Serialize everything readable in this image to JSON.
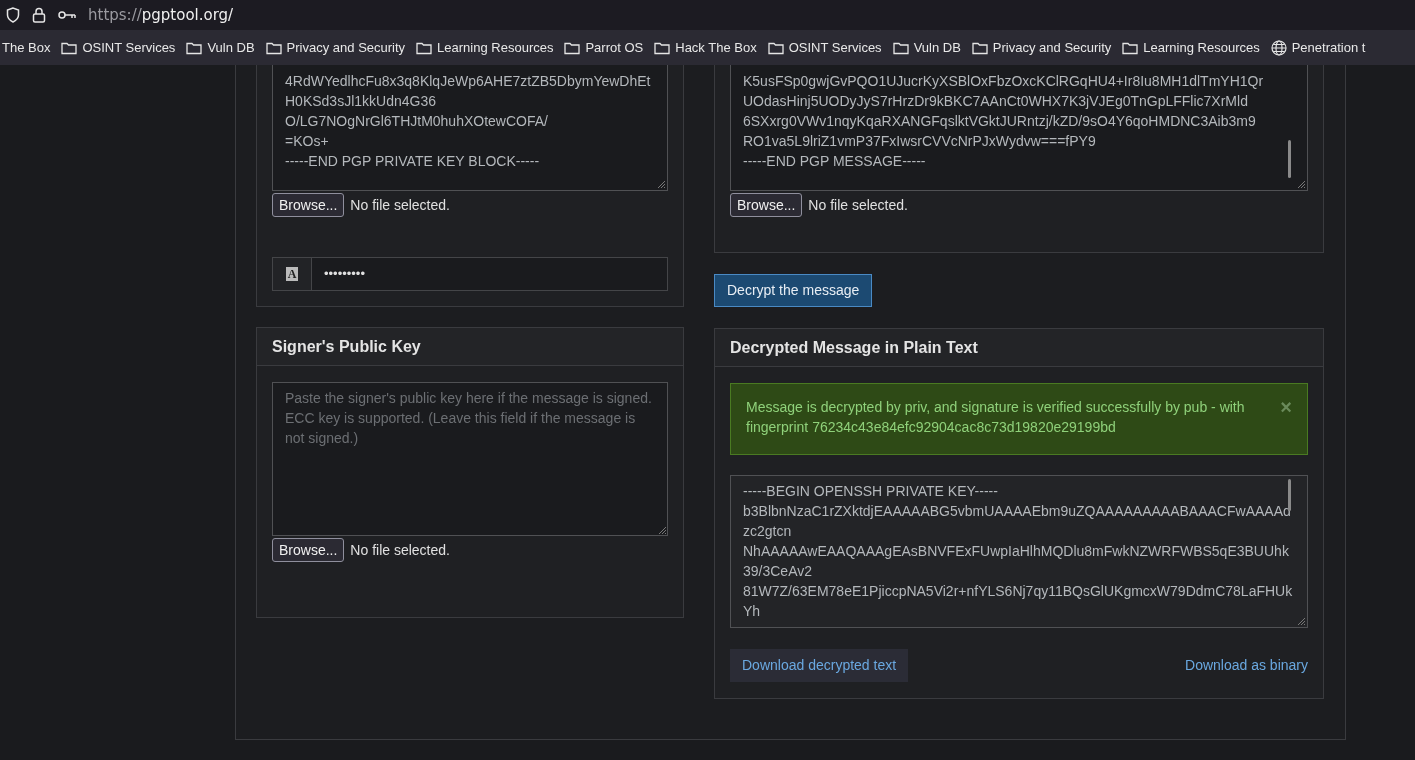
{
  "browser": {
    "url_scheme": "https://",
    "url_host": "pgptool.org/"
  },
  "bookmarks": [
    {
      "label": "The Box",
      "kind": "none"
    },
    {
      "label": "OSINT Services",
      "kind": "folder"
    },
    {
      "label": "Vuln DB",
      "kind": "folder"
    },
    {
      "label": "Privacy and Security",
      "kind": "folder"
    },
    {
      "label": "Learning Resources",
      "kind": "folder"
    },
    {
      "label": "Parrot OS",
      "kind": "folder"
    },
    {
      "label": "Hack The Box",
      "kind": "folder"
    },
    {
      "label": "OSINT Services",
      "kind": "folder"
    },
    {
      "label": "Vuln DB",
      "kind": "folder"
    },
    {
      "label": "Privacy and Security",
      "kind": "folder"
    },
    {
      "label": "Learning Resources",
      "kind": "folder"
    },
    {
      "label": "Penetration t",
      "kind": "globe"
    }
  ],
  "private_key_panel": {
    "key_lines": [
      "4RdWYedlhcFu8x3q8KlqJeWp6AHE7ztZB5DbymYewDhEt",
      "H0KSd3sJl1kkUdn4G36",
      "O/LG7NOgNrGl6THJtM0huhXOtewCOFA/",
      "=KOs+",
      "-----END PGP PRIVATE KEY BLOCK-----"
    ],
    "browse_button": "Browse...",
    "file_status": "No file selected.",
    "passphrase_icon": "A",
    "passphrase": "•••••••••"
  },
  "message_panel": {
    "message_lines": [
      "K5usFSp0gwjGvPQO1UJucrKyXSBlOxFbzOxcKClRGqHU4+Ir8Iu8MH1dlTmYH1Qr",
      "UOdasHinj5UODyJyS7rHrzDr9kBKC7AAnCt0WHX7K3jVJEg0TnGpLFFlic7XrMld",
      "6SXxrg0VWv1nqyKqaRXANGFqslktVGktJURntzj/kZD/9sO4Y6qoHMDNC3Aib3m9",
      "RO1va5L9lriZ1vmP37FxIwsrCVVcNrPJxWydvw===fPY9",
      "-----END PGP MESSAGE-----"
    ],
    "browse_button": "Browse...",
    "file_status": "No file selected."
  },
  "decrypt_button": "Decrypt the message",
  "signer_panel": {
    "title": "Signer's Public Key",
    "placeholder": "Paste the signer's public key here if the message is signed. ECC key is supported. (Leave this field if the message is not signed.)",
    "browse_button": "Browse...",
    "file_status": "No file selected."
  },
  "result_panel": {
    "title": "Decrypted Message in Plain Text",
    "alert": {
      "kind": "success",
      "text": "Message is decrypted by priv, and signature is verified successfully by pub - with fingerprint 76234c43e84efc92904cac8c73d19820e29199bd",
      "close": "×"
    },
    "output_lines": [
      "-----BEGIN OPENSSH PRIVATE KEY-----",
      "b3BlbnNzaC1rZXktdjEAAAAABG5vbmUAAAAEbm9uZQAAAAAAAAABAAACFwAAAAd",
      "zc2gtcn",
      "NhAAAAAwEAAQAAAgEAsBNVFExFUwpIaHlhMQDlu8mFwkNZWRFWBS5qE3BUUhk",
      "39/3CeAv2",
      "81W7Z/63EM78eE1PjiccpNA5Vi2r+nfYLS6Nj7qy11BQsGlUKgmcxW79DdmC78LaFHUk",
      "Yh"
    ],
    "download_button": "Download decrypted text",
    "binary_link": "Download as binary"
  }
}
